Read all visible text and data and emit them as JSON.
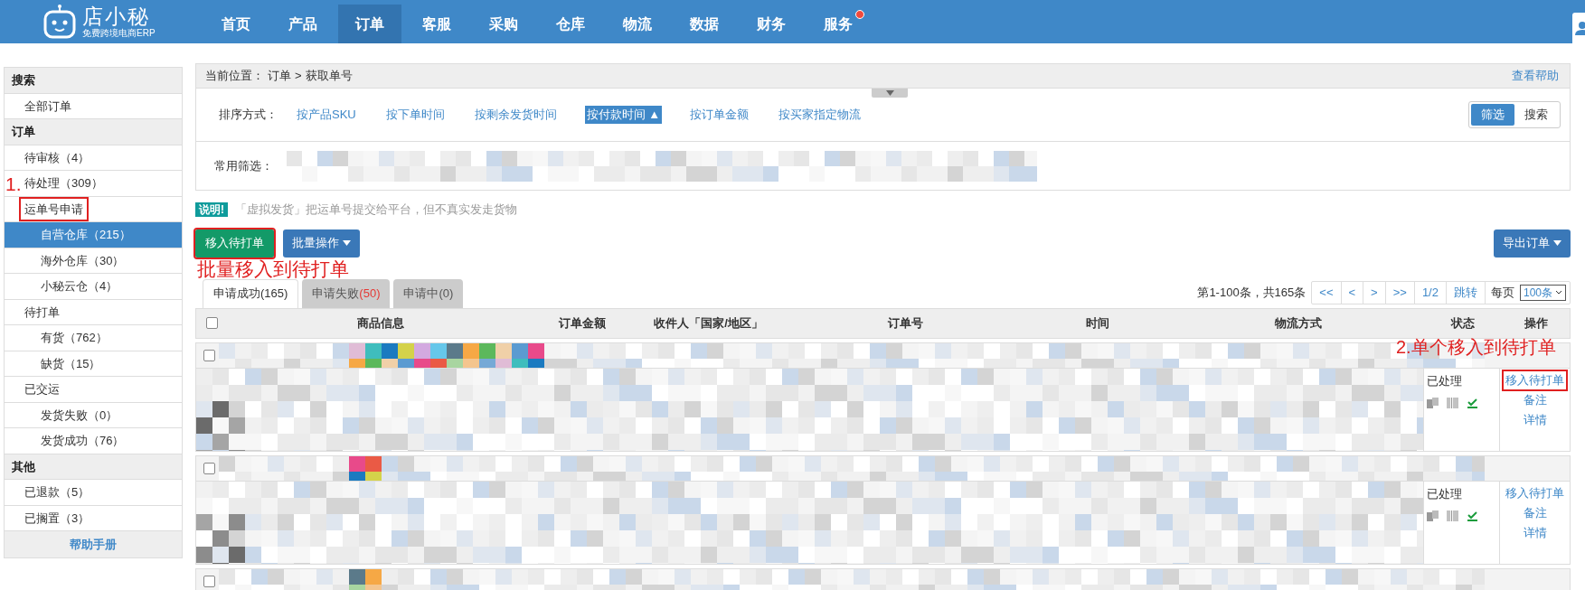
{
  "header": {
    "logo": {
      "name": "店小秘",
      "tagline": "免费跨境电商ERP"
    },
    "nav": [
      {
        "label": "首页",
        "selected": false,
        "notification": false
      },
      {
        "label": "产品",
        "selected": false,
        "notification": false
      },
      {
        "label": "订单",
        "selected": true,
        "notification": false
      },
      {
        "label": "客服",
        "selected": false,
        "notification": false
      },
      {
        "label": "采购",
        "selected": false,
        "notification": false
      },
      {
        "label": "仓库",
        "selected": false,
        "notification": false
      },
      {
        "label": "物流",
        "selected": false,
        "notification": false
      },
      {
        "label": "数据",
        "selected": false,
        "notification": false
      },
      {
        "label": "财务",
        "selected": false,
        "notification": false
      },
      {
        "label": "服务",
        "selected": false,
        "notification": true
      }
    ]
  },
  "sidebar": {
    "sections": [
      {
        "title": "搜索",
        "items": [
          {
            "label": "全部订单",
            "selected": false,
            "highlighted": false
          }
        ]
      },
      {
        "title": "订单",
        "items": [
          {
            "label": "待审核（4）",
            "selected": false,
            "highlighted": false
          },
          {
            "label": "待处理（309）",
            "selected": false,
            "highlighted": false
          },
          {
            "label": "运单号申请",
            "selected": false,
            "highlighted": true,
            "children": [
              {
                "label": "自营仓库（215）",
                "selected": true,
                "highlighted": false
              },
              {
                "label": "海外仓库（30）",
                "selected": false,
                "highlighted": false
              },
              {
                "label": "小秘云仓（4）",
                "selected": false,
                "highlighted": false
              }
            ]
          },
          {
            "label": "待打单",
            "selected": false,
            "highlighted": false,
            "children": [
              {
                "label": "有货（762）",
                "selected": false,
                "highlighted": false
              },
              {
                "label": "缺货（15）",
                "selected": false,
                "highlighted": false
              }
            ]
          },
          {
            "label": "已交运",
            "selected": false,
            "highlighted": false,
            "children": [
              {
                "label": "发货失败（0）",
                "selected": false,
                "highlighted": false
              },
              {
                "label": "发货成功（76）",
                "selected": false,
                "highlighted": false
              }
            ]
          }
        ]
      },
      {
        "title": "其他",
        "items": [
          {
            "label": "已退款（5）",
            "selected": false,
            "highlighted": false
          },
          {
            "label": "已搁置（3）",
            "selected": false,
            "highlighted": false
          }
        ]
      }
    ],
    "footer": "帮助手册"
  },
  "breadcrumb": {
    "label": "当前位置：",
    "items": [
      "订单",
      "获取单号"
    ],
    "separator": ">",
    "help": "查看帮助"
  },
  "sort": {
    "label": "排序方式：",
    "options": [
      {
        "label": "按产品SKU",
        "selected": false
      },
      {
        "label": "按下单时间",
        "selected": false
      },
      {
        "label": "按剩余发货时间",
        "selected": false
      },
      {
        "label": "按付款时间",
        "selected": true,
        "arrow": "▲"
      },
      {
        "label": "按订单金额",
        "selected": false
      },
      {
        "label": "按买家指定物流",
        "selected": false
      }
    ]
  },
  "mode_toggle": [
    {
      "label": "筛选",
      "selected": true
    },
    {
      "label": "搜索",
      "selected": false
    }
  ],
  "filter": {
    "label": "常用筛选："
  },
  "note": {
    "badge": "说明!",
    "text": "「虚拟发货」把运单号提交给平台，但不真实发走货物"
  },
  "actions": {
    "move": {
      "label": "移入待打单",
      "highlighted": true
    },
    "batch": "批量操作",
    "export": "导出订单"
  },
  "annotations": {
    "step_1": "1.",
    "bulk_move": "批量移入到待打单",
    "single_move": "2.单个移入到待打单"
  },
  "tabs": [
    {
      "label": "申请成功",
      "count": "(165)",
      "selected": true,
      "alert": false
    },
    {
      "label": "申请失败",
      "count": "(50)",
      "selected": false,
      "alert": true
    },
    {
      "label": "申请中",
      "count": "(0)",
      "selected": false,
      "alert": false
    }
  ],
  "pagination": {
    "summary": "第1-100条，共165条",
    "buttons": [
      "<<",
      "<",
      ">",
      ">>",
      "1/2",
      "跳转"
    ],
    "per_page_label": "每页",
    "per_page": "100条"
  },
  "table": {
    "select_all_checked": false,
    "columns": [
      "商品信息",
      "订单金额",
      "收件人「国家/地区」",
      "订单号",
      "时间",
      "物流方式",
      "状态",
      "操作"
    ],
    "orders": [
      {
        "kind": "full",
        "checked": false,
        "status": "已处理",
        "actions": [
          {
            "label": "移入待打单",
            "highlighted": true
          },
          {
            "label": "备注",
            "highlighted": false
          },
          {
            "label": "详情",
            "highlighted": false
          }
        ]
      },
      {
        "kind": "full",
        "checked": false,
        "status": "已处理",
        "actions": [
          {
            "label": "移入待打单",
            "highlighted": false
          },
          {
            "label": "备注",
            "highlighted": false
          },
          {
            "label": "详情",
            "highlighted": false
          }
        ]
      },
      {
        "kind": "header_only",
        "checked": false
      }
    ]
  }
}
